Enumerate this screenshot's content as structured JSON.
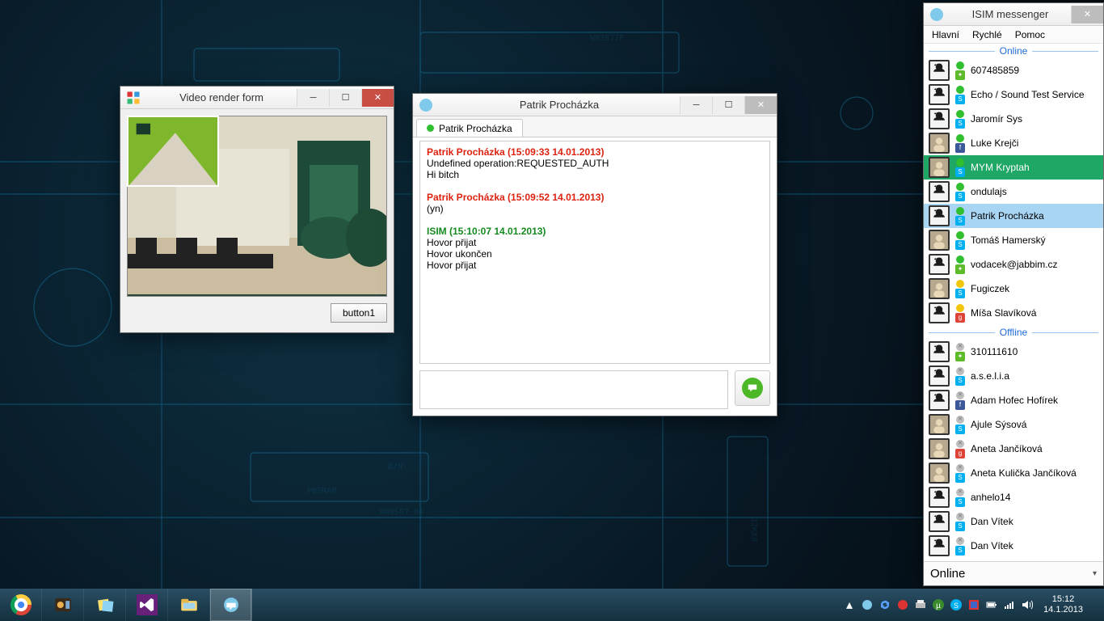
{
  "video_window": {
    "title": "Video render form",
    "button_label": "button1"
  },
  "chat_window": {
    "title": "Patrik Procházka",
    "tab_label": "Patrik Procházka",
    "messages": [
      {
        "header": "Patrik Procházka (15:09:33  14.01.2013)",
        "kind": "red",
        "lines": [
          "Undefined operation:REQUESTED_AUTH",
          "Hi bitch"
        ]
      },
      {
        "header": "Patrik Procházka (15:09:52  14.01.2013)",
        "kind": "red",
        "lines": [
          "(yn)"
        ]
      },
      {
        "header": "ISIM (15:10:07  14.01.2013)",
        "kind": "green",
        "lines": [
          "Hovor přijat",
          "Hovor ukončen",
          "Hovor přijat"
        ]
      }
    ]
  },
  "messenger": {
    "title": "ISIM messenger",
    "menu": {
      "main": "Hlavní",
      "quick": "Rychlé",
      "help": "Pomoc"
    },
    "section_online": "Online",
    "section_offline": "Offline",
    "status_label": "Online",
    "contacts_online": [
      {
        "name": "607485859",
        "presence": "on",
        "proto": "pp",
        "avatar": "sil"
      },
      {
        "name": "Echo / Sound Test Service",
        "presence": "on",
        "proto": "sk",
        "avatar": "sil"
      },
      {
        "name": "Jaromír Sys",
        "presence": "on",
        "proto": "sk",
        "avatar": "sil"
      },
      {
        "name": "Luke Krejči",
        "presence": "on",
        "proto": "fb",
        "avatar": "photo"
      },
      {
        "name": "MYM Kryptah",
        "presence": "on",
        "proto": "sk",
        "avatar": "photo",
        "select": "green"
      },
      {
        "name": "ondulajs",
        "presence": "on",
        "proto": "sk",
        "avatar": "sil"
      },
      {
        "name": "Patrik Procházka",
        "presence": "on",
        "proto": "sk",
        "avatar": "sil",
        "select": "blue"
      },
      {
        "name": "Tomáš Hamerský",
        "presence": "on",
        "proto": "sk",
        "avatar": "photo"
      },
      {
        "name": "vodacek@jabbim.cz",
        "presence": "on",
        "proto": "pp",
        "avatar": "sil"
      },
      {
        "name": "Fugiczek",
        "presence": "away",
        "proto": "sk",
        "avatar": "photo"
      },
      {
        "name": "Míša Slavíková",
        "presence": "away",
        "proto": "gg",
        "avatar": "sil"
      }
    ],
    "contacts_offline": [
      {
        "name": "310111610",
        "presence": "off",
        "proto": "pp",
        "avatar": "sil"
      },
      {
        "name": "a.s.e.l.i.a",
        "presence": "off",
        "proto": "sk",
        "avatar": "sil"
      },
      {
        "name": "Adam Hofec Hofírek",
        "presence": "off",
        "proto": "fb",
        "avatar": "sil"
      },
      {
        "name": "Ajule Sýsová",
        "presence": "off",
        "proto": "sk",
        "avatar": "photo"
      },
      {
        "name": "Aneta Jančíková",
        "presence": "off",
        "proto": "gg",
        "avatar": "photo"
      },
      {
        "name": "Aneta Kulička Jančíková",
        "presence": "off",
        "proto": "sk",
        "avatar": "photo"
      },
      {
        "name": "anhelo14",
        "presence": "off",
        "proto": "sk",
        "avatar": "sil"
      },
      {
        "name": "Dan Vítek",
        "presence": "off",
        "proto": "sk",
        "avatar": "sil"
      },
      {
        "name": "Dan Vítek",
        "presence": "off",
        "proto": "sk",
        "avatar": "sil"
      }
    ]
  },
  "taskbar": {
    "time": "15:12",
    "date": "14.1.2013"
  }
}
